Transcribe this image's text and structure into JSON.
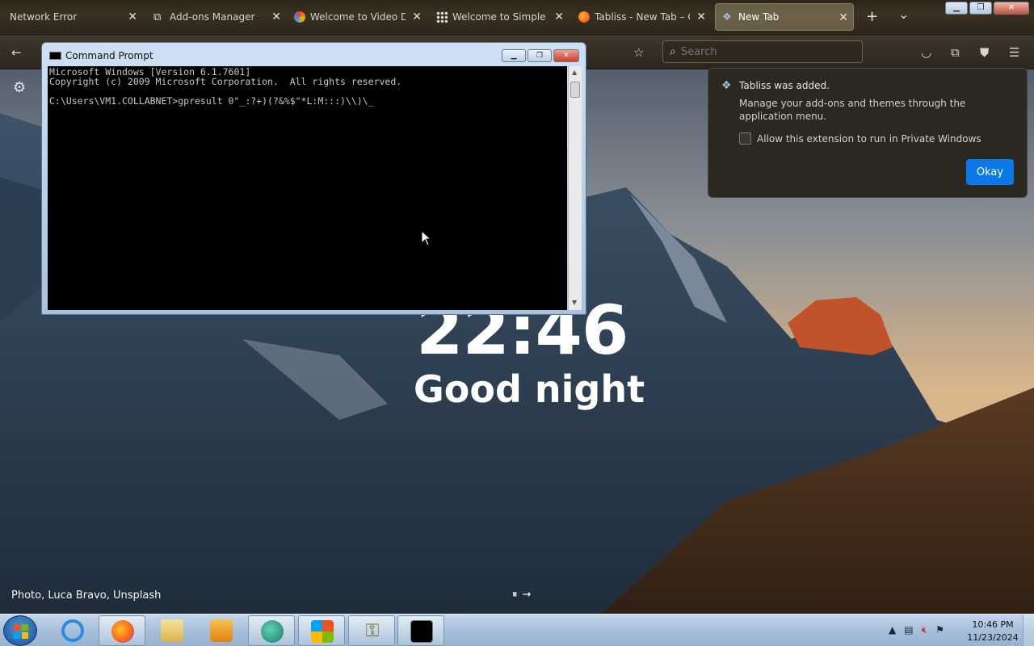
{
  "browser": {
    "tabs": [
      {
        "title": "Network Error",
        "active": false
      },
      {
        "title": "Add-ons Manager",
        "active": false
      },
      {
        "title": "Welcome to Video Do",
        "active": false
      },
      {
        "title": "Welcome to Simple Ta",
        "active": false
      },
      {
        "title": "Tabliss - New Tab – Ge",
        "active": false
      },
      {
        "title": "New Tab",
        "active": true
      }
    ],
    "new_tab_label": "+",
    "tab_list_label": "⌄",
    "search_placeholder": "Search"
  },
  "newtab": {
    "clock": "22:46",
    "greeting": "Good night",
    "photo_credit": "Photo, Luca Bravo, Unsplash",
    "settings_icon": "gear-icon"
  },
  "addon_popup": {
    "title": "Tabliss was added.",
    "body": "Manage your add-ons and themes through the application menu.",
    "checkbox_label": "Allow this extension to run in Private Windows",
    "checkbox_checked": false,
    "ok_label": "Okay"
  },
  "cmd": {
    "title": "Command Prompt",
    "lines": [
      "Microsoft Windows [Version 6.1.7601]",
      "Copyright (c) 2009 Microsoft Corporation.  All rights reserved.",
      "",
      "C:\\Users\\VM1.COLLABNET>gpresult 0\"_:?+)(?&%$\"*L:M:::)\\\\)\\_"
    ]
  },
  "taskbar": {
    "time": "10:46 PM",
    "date": "11/23/2024",
    "items": [
      "internet-explorer",
      "firefox",
      "file-explorer",
      "media-player",
      "app-globe",
      "windows-update",
      "key-tool",
      "command-prompt"
    ]
  },
  "colors": {
    "accent": "#0a78e8",
    "console_bg": "#000000",
    "console_fg": "#c8c8c8"
  }
}
